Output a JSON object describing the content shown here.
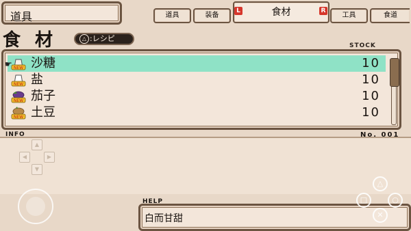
{
  "category_box": {
    "label": "道具"
  },
  "tabs": [
    {
      "label": "道具"
    },
    {
      "label": "装备"
    },
    {
      "label": "食材"
    },
    {
      "label": "工具"
    },
    {
      "label": "食道"
    }
  ],
  "triggers": {
    "left": "L",
    "right": "R"
  },
  "section": {
    "title": "食 材",
    "recipe_button": ":レシピ",
    "stock_label": "STOCK"
  },
  "items": [
    {
      "name": "沙糖",
      "badge": "NEW",
      "qty": "10",
      "selected": true,
      "icon": "sugar-bag-icon"
    },
    {
      "name": "盐",
      "badge": "NEW",
      "qty": "10",
      "selected": false,
      "icon": "salt-bag-icon"
    },
    {
      "name": "茄子",
      "badge": "NEW",
      "qty": "10",
      "selected": false,
      "icon": "eggplant-icon"
    },
    {
      "name": "土豆",
      "badge": "NEW",
      "qty": "10",
      "selected": false,
      "icon": "potato-icon"
    }
  ],
  "info": {
    "label": "INFO",
    "number": "No. 001"
  },
  "help": {
    "label": "HELP",
    "text": "白而甘甜"
  },
  "controls": {
    "triangle": "△",
    "square": "□",
    "circle": "○",
    "cross": "✕"
  },
  "colors": {
    "selection": "#8fe2c6",
    "frame": "#6b5441",
    "panel": "#f3e6da",
    "trigger": "#d6362b"
  }
}
